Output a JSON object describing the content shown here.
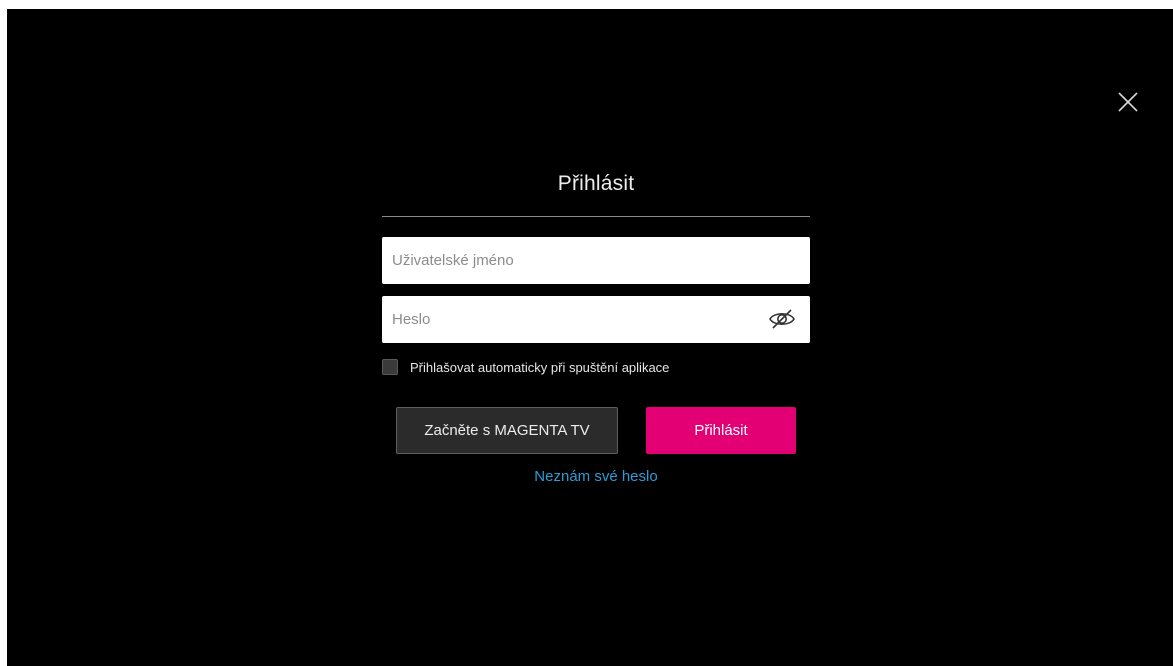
{
  "dialog": {
    "title": "Přihlásit",
    "close_icon": "close-icon"
  },
  "form": {
    "username": {
      "value": "",
      "placeholder": "Uživatelské jméno"
    },
    "password": {
      "value": "",
      "placeholder": "Heslo",
      "toggle_icon": "eye-slash-icon"
    },
    "remember": {
      "label": "Přihlašovat automaticky při spuštění aplikace",
      "checked": false
    }
  },
  "buttons": {
    "start_label": "Začněte s MAGENTA TV",
    "login_label": "Přihlásit"
  },
  "links": {
    "forgot_password": "Neznám své heslo"
  },
  "colors": {
    "background": "#000000",
    "accent": "#e20074",
    "link": "#2e9bd6"
  }
}
